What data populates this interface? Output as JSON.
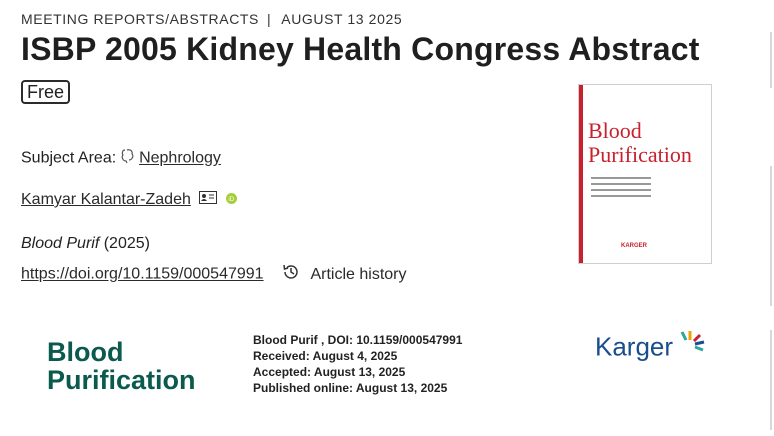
{
  "meta": {
    "category": "MEETING REPORTS/ABSTRACTS",
    "separator": "|",
    "date": "AUGUST 13 2025"
  },
  "title": "ISBP 2005 Kidney Health Congress Abstract",
  "badge": "Free",
  "subject": {
    "label": "Subject Area:",
    "value": "Nephrology"
  },
  "author": {
    "name": "Kamyar Kalantar-Zadeh"
  },
  "citation": {
    "journal": "Blood Purif",
    "year": "(2025)"
  },
  "doi": {
    "url": "https://doi.org/10.1159/000547991",
    "history_label": "Article history"
  },
  "cover": {
    "title_line1": "Blood",
    "title_line2": "Purification",
    "publisher": "KARGER"
  },
  "banner": {
    "logo_line1": "Blood",
    "logo_line2": "Purification",
    "info_line1": "Blood Purif , DOI: 10.1159/000547991",
    "info_line2": "Received: August 4, 2025",
    "info_line3": "Accepted: August 13, 2025",
    "info_line4": "Published online: August 13, 2025",
    "publisher": "Karger"
  },
  "colors": {
    "journal_red": "#c8202c",
    "journal_green": "#0b5a4e",
    "karger_blue": "#1a4d8f",
    "orcid_green": "#a6ce39"
  },
  "icons": [
    "brain-icon",
    "contact-card-icon",
    "orcid-icon",
    "history-icon"
  ]
}
